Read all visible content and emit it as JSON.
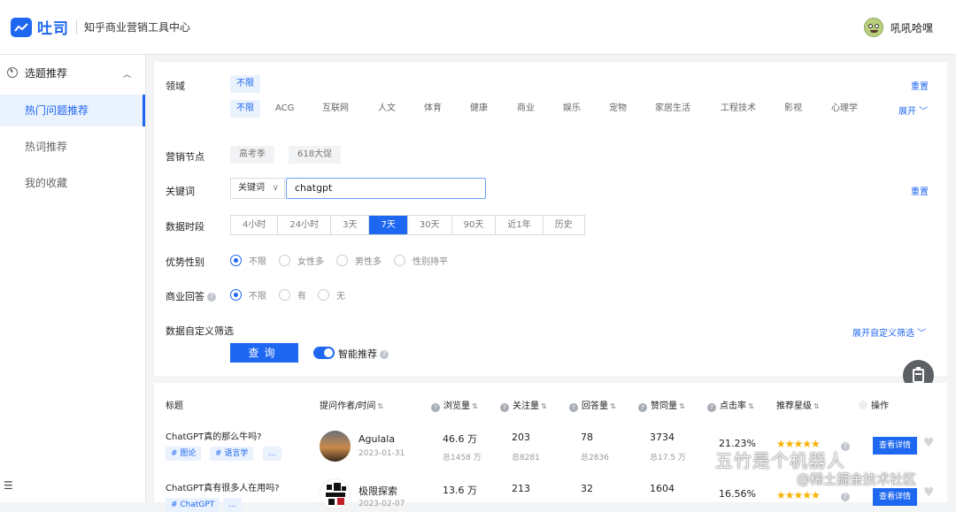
{
  "header": {
    "logo_text": "吐司",
    "subtitle": "知乎商业营销工具中心",
    "username": "吼吼哈嘿"
  },
  "sidebar": {
    "section_label": "选题推荐",
    "items": [
      {
        "label": "热门问题推荐",
        "active": true
      },
      {
        "label": "热词推荐",
        "active": false
      },
      {
        "label": "我的收藏",
        "active": false
      }
    ]
  },
  "filters": {
    "domain_label": "领域",
    "domain_selected": "不限",
    "domain_reset": "重置",
    "domain_options": [
      "不限",
      "ACG",
      "互联网",
      "人文",
      "体育",
      "健康",
      "商业",
      "娱乐",
      "宠物",
      "家居生活",
      "工程技术",
      "影视",
      "心理学"
    ],
    "expand_label": "展开",
    "marketing_label": "营销节点",
    "marketing_options": [
      "高考季",
      "618大促"
    ],
    "keyword_label": "关键词",
    "keyword_type": "关键词",
    "keyword_value": "chatgpt",
    "keyword_reset": "重置",
    "period_label": "数据时段",
    "period_options": [
      "4小时",
      "24小时",
      "3天",
      "7天",
      "30天",
      "90天",
      "近1年",
      "历史"
    ],
    "period_selected": "7天",
    "gender_label": "优势性别",
    "gender_options": [
      "不限",
      "女性多",
      "男性多",
      "性别持平"
    ],
    "gender_selected": "不限",
    "business_label": "商业回答",
    "business_options": [
      "不限",
      "有",
      "无"
    ],
    "business_selected": "不限",
    "custom_label": "数据自定义筛选",
    "custom_expand": "展开自定义筛选",
    "query_button": "查询",
    "smart_label": "智能推荐",
    "smart_on": true
  },
  "table": {
    "columns": [
      "标题",
      "提问作者/时间",
      "浏览量",
      "关注量",
      "回答量",
      "赞同量",
      "点击率",
      "推荐星级",
      "操作"
    ],
    "sort_glyph": "⇅",
    "rows": [
      {
        "title": "ChatGPT真的那么牛吗?",
        "topics": [
          "# 图论",
          "# 语言学",
          "..."
        ],
        "author": "Agulala",
        "date": "2023-01-31",
        "views": "46.6 万",
        "views_total": "总1458 万",
        "follows": "203",
        "follows_total": "总8281",
        "answers": "78",
        "answers_total": "总2836",
        "likes": "3734",
        "likes_total": "总17.5 万",
        "ctr": "21.23%",
        "stars": "★★★★★",
        "detail_button": "查看详情"
      },
      {
        "title": "ChatGPT真有很多人在用吗?",
        "topics": [
          "# ChatGPT",
          "..."
        ],
        "author": "极限探索",
        "date": "2023-02-07",
        "views": "13.6 万",
        "follows": "213",
        "answers": "32",
        "likes": "1604",
        "ctr": "16.56%",
        "stars": "★★★★★",
        "detail_button": "查看详情"
      }
    ]
  },
  "watermark": {
    "line1": "五竹是个机器人",
    "line2": "@稀土掘金技术社区"
  }
}
